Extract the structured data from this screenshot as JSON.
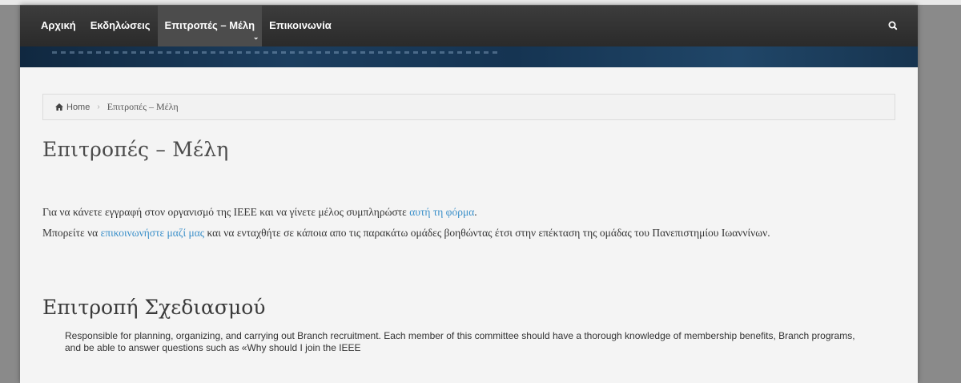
{
  "nav": {
    "items": [
      {
        "label": "Αρχική"
      },
      {
        "label": "Εκδηλώσεις"
      },
      {
        "label": "Επιτροπές – Μέλη"
      },
      {
        "label": "Επικοινωνία"
      }
    ],
    "caret": "⌄",
    "search_icon": "search-icon"
  },
  "breadcrumb": {
    "home": "Home",
    "separator": "›",
    "current": "Επιτροπές – Μέλη"
  },
  "page": {
    "title": "Επιτροπές – Μέλη",
    "p1_text": "Για να κάνετε εγγραφή στον οργανισμό της IEEΕ και να γίνετε μέλος συμπληρώστε ",
    "p1_link": "αυτή τη φόρμα",
    "p1_end": ".",
    "p2_start": "Μπορείτε να ",
    "p2_link": "επικοινωνήστε μαζί μας",
    "p2_text": " και να ενταχθήτε σε κάποια απο τις παρακάτω ομάδες βοηθώντας έτσι στην επέκταση της ομάδας του Πανεπιστημίου Ιωαννίνων."
  },
  "section": {
    "title": "Επιτροπή Σχεδιασμού",
    "body": "Responsible for planning, organizing, and carrying out Branch recruitment. Each member of this committee should have a thorough knowledge of membership benefits, Branch programs, and be able to answer questions such as «Why should I join the IEEE"
  },
  "colors": {
    "link": "#3a8fc9",
    "nav_bg": "#2f2f2f",
    "banner": "#1c3e5f"
  }
}
